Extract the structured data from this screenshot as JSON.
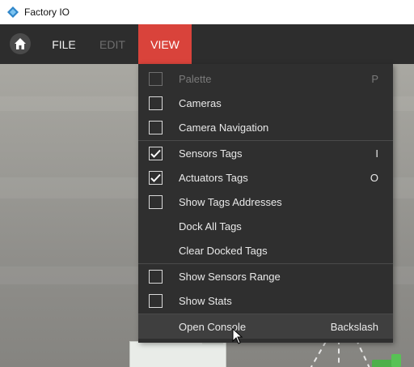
{
  "window": {
    "title": "Factory IO"
  },
  "menubar": {
    "home_icon": "home-icon",
    "items": [
      {
        "label": "FILE",
        "state": "normal"
      },
      {
        "label": "EDIT",
        "state": "disabled"
      },
      {
        "label": "VIEW",
        "state": "active"
      }
    ]
  },
  "view_menu": {
    "items": [
      {
        "label": "Palette",
        "checkbox": true,
        "checked": false,
        "disabled": true,
        "shortcut": "P"
      },
      {
        "label": "Cameras",
        "checkbox": true,
        "checked": false,
        "disabled": false,
        "shortcut": ""
      },
      {
        "label": "Camera Navigation",
        "checkbox": true,
        "checked": false,
        "disabled": false,
        "shortcut": ""
      },
      {
        "label": "Sensors Tags",
        "checkbox": true,
        "checked": true,
        "disabled": false,
        "shortcut": "I"
      },
      {
        "label": "Actuators Tags",
        "checkbox": true,
        "checked": true,
        "disabled": false,
        "shortcut": "O"
      },
      {
        "label": "Show Tags Addresses",
        "checkbox": true,
        "checked": false,
        "disabled": false,
        "shortcut": ""
      },
      {
        "label": "Dock All Tags",
        "checkbox": false,
        "disabled": false,
        "shortcut": ""
      },
      {
        "label": "Clear Docked Tags",
        "checkbox": false,
        "disabled": false,
        "shortcut": ""
      },
      {
        "label": "Show Sensors Range",
        "checkbox": true,
        "checked": false,
        "disabled": false,
        "shortcut": ""
      },
      {
        "label": "Show Stats",
        "checkbox": true,
        "checked": false,
        "disabled": false,
        "shortcut": ""
      },
      {
        "label": "Open Console",
        "checkbox": false,
        "disabled": false,
        "shortcut": "Backslash",
        "highlighted": true
      }
    ]
  },
  "colors": {
    "accent": "#d9433b",
    "menubar": "#2d2d2d",
    "dropdown": "#2f2f2f"
  }
}
